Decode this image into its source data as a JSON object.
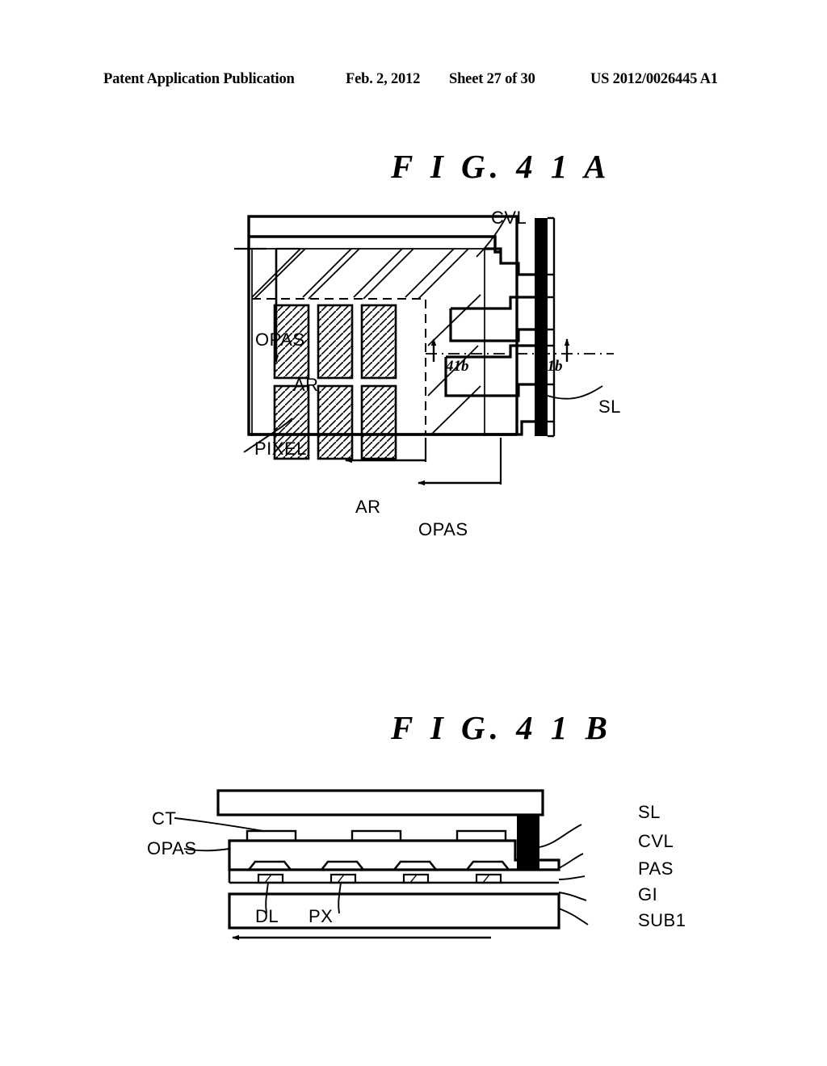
{
  "header": {
    "publication": "Patent Application Publication",
    "date": "Feb. 2, 2012",
    "sheet": "Sheet 27 of 30",
    "patent_number": "US 2012/0026445 A1"
  },
  "figures": [
    {
      "id": "fig-41a",
      "title": "F I G. 4 1 A",
      "type": "plan-view",
      "labels": {
        "cvl": "CVL",
        "opas_left": "OPAS",
        "ar_left": "AR",
        "pixel": "PIXEL",
        "sl": "SL",
        "ar_bottom": "AR",
        "opas_bottom": "OPAS",
        "section_left": "41b",
        "section_right": "41b"
      },
      "pixel_grid": {
        "rows": 2,
        "cols": 3
      }
    },
    {
      "id": "fig-41b",
      "title": "F I G. 4 1 B",
      "type": "cross-section",
      "labels": {
        "ct": "CT",
        "opas": "OPAS",
        "dl": "DL",
        "px": "PX",
        "sl": "SL",
        "cvl": "CVL",
        "pas": "PAS",
        "gi": "GI",
        "sub1": "SUB1"
      }
    }
  ],
  "colors": {
    "ink": "#000000",
    "paper": "#ffffff"
  }
}
